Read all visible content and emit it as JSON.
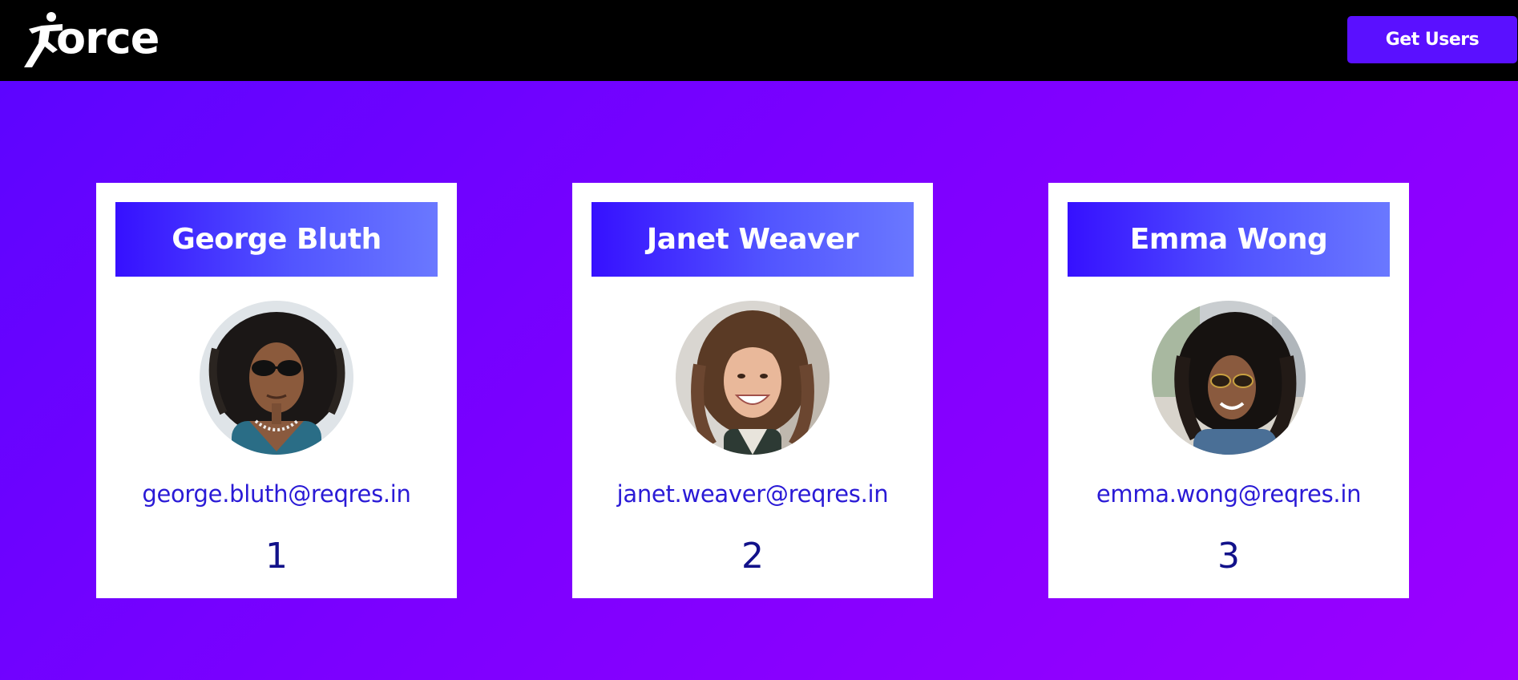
{
  "navbar": {
    "logo_text": "orce",
    "logo_icon": "runner-icon",
    "button_label": "Get Users"
  },
  "colors": {
    "navbar_bg": "#000000",
    "button_bg": "#5a10ff",
    "page_gradient_start": "#5a05ff",
    "page_gradient_end": "#9b00ff",
    "card_header_start": "#3610ff",
    "card_header_end": "#6a78ff",
    "email_text": "#2a1ad6",
    "id_text": "#12128a"
  },
  "users": [
    {
      "name": "George Bluth",
      "email": "george.bluth@reqres.in",
      "id": "1"
    },
    {
      "name": "Janet Weaver",
      "email": "janet.weaver@reqres.in",
      "id": "2"
    },
    {
      "name": "Emma Wong",
      "email": "emma.wong@reqres.in",
      "id": "3"
    }
  ]
}
